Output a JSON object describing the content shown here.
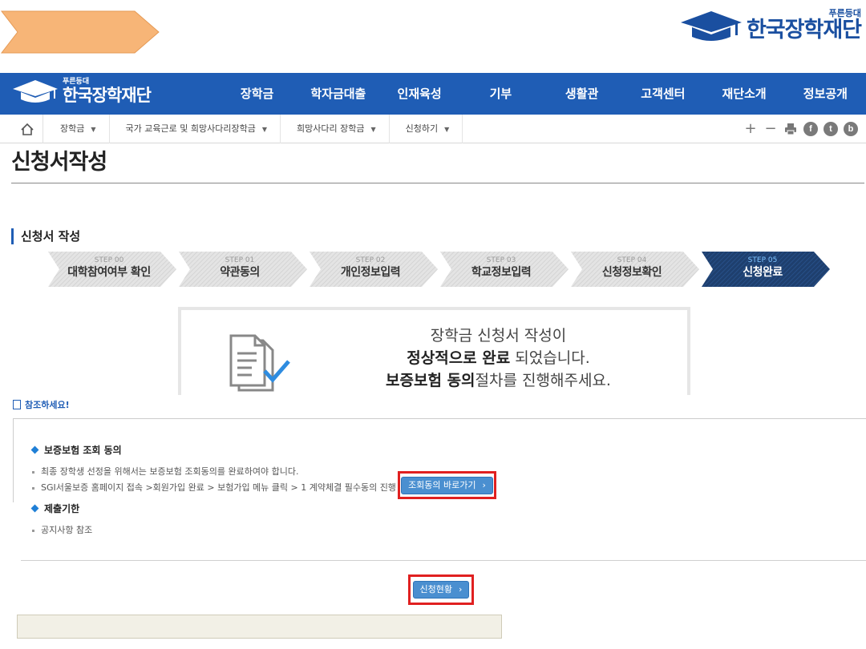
{
  "header": {
    "logo_sub": "푸른등대",
    "logo_main": "한국장학재단"
  },
  "nav": {
    "logo_sub": "푸른등대",
    "logo_main": "한국장학재단",
    "items": [
      "장학금",
      "학자금대출",
      "인재육성",
      "기부",
      "생활관",
      "고객센터",
      "재단소개",
      "정보공개"
    ]
  },
  "breadcrumb": {
    "items": [
      "장학금",
      "국가 교육근로 및 희망사다리장학금",
      "희망사다리 장학금",
      "신청하기"
    ]
  },
  "toolbar": {
    "zoom_in": "+",
    "zoom_out": "−",
    "facebook": "f",
    "twitter": "t",
    "blog": "b"
  },
  "page_title": "신청서작성",
  "section_title": "신청서 작성",
  "steps": [
    {
      "num": "STEP 00",
      "name": "대학참여여부 확인"
    },
    {
      "num": "STEP 01",
      "name": "약관동의"
    },
    {
      "num": "STEP 02",
      "name": "개인정보입력"
    },
    {
      "num": "STEP 03",
      "name": "학교정보입력"
    },
    {
      "num": "STEP 04",
      "name": "신청정보확인"
    },
    {
      "num": "STEP 05",
      "name": "신청완료"
    }
  ],
  "completion": {
    "line1": "장학금 신청서 작성이",
    "line2_bold": "정상적으로 완료",
    "line2_rest": " 되었습니다.",
    "line3_bold": "보증보험 동의",
    "line3_rest": "절차를 진행해주세요."
  },
  "reference": {
    "title": "참조하세요!",
    "insurance_heading": "보증보험 조회 동의",
    "bullet1": "최종 장학생 선정을 위해서는 보증보험 조회동의를 완료하여야 합니다.",
    "bullet2": "SGI서울보증 홈페이지 접속 >회원가입 완료 > 보험가입 메뉴 클릭 > 1 계약체결 필수동의 진행",
    "goto_button": "조회동의 바로가기",
    "deadline_heading": "제출기한",
    "bullet3": "공지사항 참조"
  },
  "status_button": "신청현황"
}
